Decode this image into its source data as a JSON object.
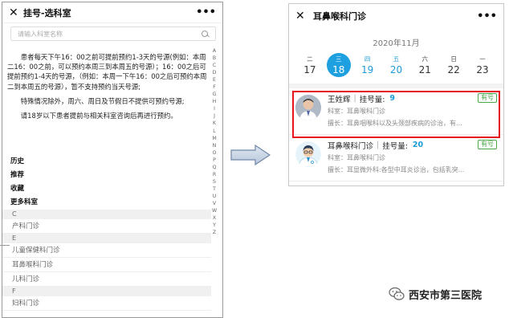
{
  "left": {
    "title": "挂号-选科室",
    "search_placeholder": "请输入科室名称",
    "notice": [
      "患者每天下午16：00之前可提前预约1-3天的号源(例如：本周二16：00之前，可以预约本周三到本周五的号源）；16：00之后可提前预约1-4天的号源，（例如：本周一下午16：00之后可预约本周二到本周五的号源），暂不支持预约当天号源;",
      "特殊情况除外，周六、周日及节假日不提供可预约号源;",
      "请18岁以下患者提前与相关科室咨询后再进行预约。"
    ],
    "quick_links": [
      "历史",
      "推荐",
      "收藏",
      "更多科室"
    ],
    "groups": [
      {
        "letter": "C",
        "departments": [
          "产科门诊"
        ]
      },
      {
        "letter": "E",
        "departments": [
          "儿童保健科门诊",
          "耳鼻喉科门诊",
          "儿科门诊"
        ]
      },
      {
        "letter": "F",
        "departments": [
          "妇科门诊"
        ]
      }
    ],
    "alphabet": [
      "A",
      "B",
      "C",
      "D",
      "E",
      "F",
      "G",
      "H",
      "I",
      "J",
      "K",
      "L",
      "M",
      "N",
      "O",
      "P",
      "Q",
      "R",
      "S",
      "T",
      "U",
      "V",
      "W",
      "X",
      "Y",
      "Z"
    ]
  },
  "right": {
    "title": "耳鼻喉科门诊",
    "month": "2020年11月",
    "days": [
      {
        "weekday": "二",
        "date": "17",
        "state": "normal"
      },
      {
        "weekday": "三",
        "date": "18",
        "state": "selected"
      },
      {
        "weekday": "四",
        "date": "19",
        "state": "blue"
      },
      {
        "weekday": "五",
        "date": "20",
        "state": "blue"
      },
      {
        "weekday": "六",
        "date": "21",
        "state": "normal"
      },
      {
        "weekday": "日",
        "date": "22",
        "state": "normal"
      },
      {
        "weekday": "一",
        "date": "23",
        "state": "normal"
      }
    ],
    "doctors": [
      {
        "name": "王姓辉",
        "count_label": "挂号量:",
        "count": "9",
        "badge": "有号",
        "dept": "科室：耳鼻喉科门诊",
        "skill": "擅长：耳鼻咽喉科以及头颈部疾病的诊治，有..."
      },
      {
        "name": "耳鼻喉科门诊",
        "count_label": "挂号量:",
        "count": "20",
        "badge": "有号",
        "dept": "科室：耳鼻喉科门诊",
        "skill": "擅长：耳显微外科:各型中耳炎诊治，包括乳突..."
      }
    ]
  },
  "watermark": "西安市第三医院",
  "colors": {
    "accent": "#1ea0e0",
    "highlight": "#e8141c",
    "badge": "#4aa84a"
  }
}
